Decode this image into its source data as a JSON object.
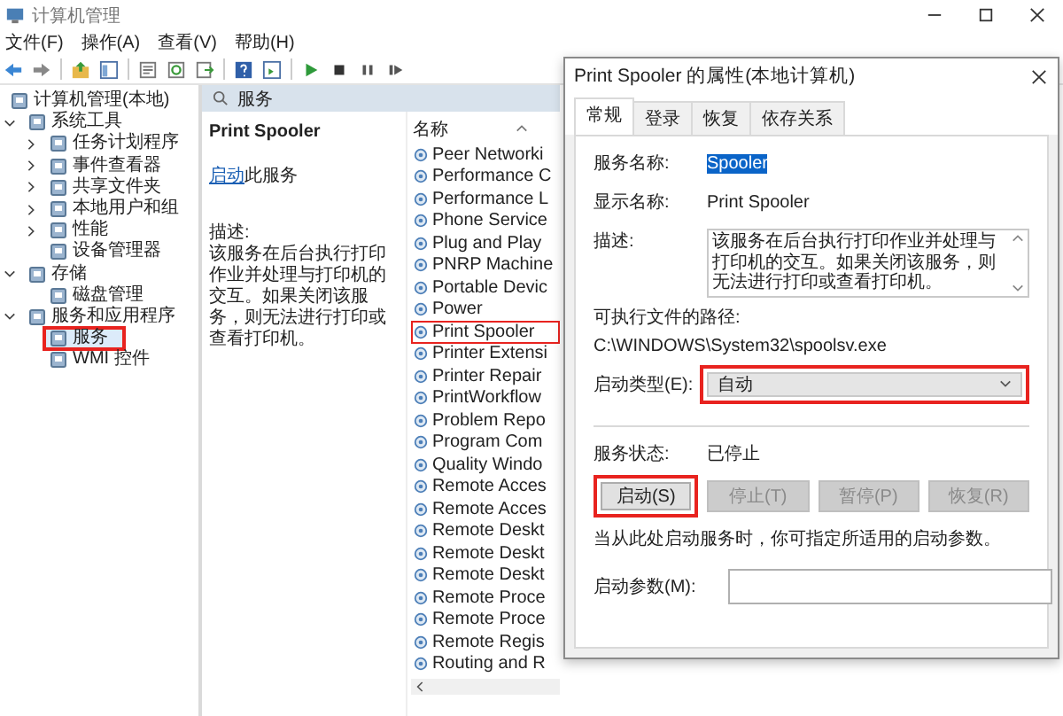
{
  "window": {
    "title": "计算机管理"
  },
  "menu": [
    "文件(F)",
    "操作(A)",
    "查看(V)",
    "帮助(H)"
  ],
  "tree": {
    "label": "计算机管理(本地)",
    "selected": false,
    "highlighted": false,
    "children": [
      {
        "label": "系统工具",
        "expanded": true,
        "selected": false,
        "highlighted": false,
        "children": [
          {
            "label": "任务计划程序",
            "expanded": false,
            "selected": false,
            "highlighted": false
          },
          {
            "label": "事件查看器",
            "expanded": false,
            "selected": false,
            "highlighted": false
          },
          {
            "label": "共享文件夹",
            "expanded": false,
            "selected": false,
            "highlighted": false
          },
          {
            "label": "本地用户和组",
            "expanded": false,
            "selected": false,
            "highlighted": false
          },
          {
            "label": "性能",
            "expanded": false,
            "selected": false,
            "highlighted": false
          },
          {
            "label": "设备管理器",
            "selected": false,
            "highlighted": false
          }
        ]
      },
      {
        "label": "存储",
        "expanded": true,
        "selected": false,
        "highlighted": false,
        "children": [
          {
            "label": "磁盘管理",
            "selected": false,
            "highlighted": false
          }
        ]
      },
      {
        "label": "服务和应用程序",
        "expanded": true,
        "selected": false,
        "highlighted": false,
        "children": [
          {
            "label": "服务",
            "selected": true,
            "highlighted": true
          },
          {
            "label": "WMI 控件",
            "selected": false,
            "highlighted": false
          }
        ]
      }
    ]
  },
  "services_panel": {
    "title": "服务",
    "detail": {
      "name": "Print Spooler",
      "action_link": "启动",
      "action_text": "此服务",
      "description_label": "描述:",
      "description": "该服务在后台执行打印作业并处理与打印机的交互。如果关闭该服务，则无法进行打印或查看打印机。"
    },
    "list": {
      "column": "名称",
      "rows": [
        {
          "name": "Peer Networki",
          "highlighted": false
        },
        {
          "name": "Performance C",
          "highlighted": false
        },
        {
          "name": "Performance L",
          "highlighted": false
        },
        {
          "name": "Phone Service",
          "highlighted": false
        },
        {
          "name": "Plug and Play",
          "highlighted": false
        },
        {
          "name": "PNRP Machine",
          "highlighted": false
        },
        {
          "name": "Portable Devic",
          "highlighted": false
        },
        {
          "name": "Power",
          "highlighted": false
        },
        {
          "name": "Print Spooler",
          "highlighted": true
        },
        {
          "name": "Printer Extensi",
          "highlighted": false
        },
        {
          "name": "Printer Repair",
          "highlighted": false
        },
        {
          "name": "PrintWorkflow",
          "highlighted": false
        },
        {
          "name": "Problem Repo",
          "highlighted": false
        },
        {
          "name": "Program Com",
          "highlighted": false
        },
        {
          "name": "Quality Windo",
          "highlighted": false
        },
        {
          "name": "Remote Acces",
          "highlighted": false
        },
        {
          "name": "Remote Acces",
          "highlighted": false
        },
        {
          "name": "Remote Deskt",
          "highlighted": false
        },
        {
          "name": "Remote Deskt",
          "highlighted": false
        },
        {
          "name": "Remote Deskt",
          "highlighted": false
        },
        {
          "name": "Remote Proce",
          "highlighted": false
        },
        {
          "name": "Remote Proce",
          "highlighted": false
        },
        {
          "name": "Remote Regis",
          "highlighted": false
        },
        {
          "name": "Routing and R",
          "highlighted": false
        }
      ]
    }
  },
  "dialog": {
    "title": "Print Spooler 的属性(本地计算机)",
    "tabs": [
      {
        "label": "常规",
        "selected": true
      },
      {
        "label": "登录",
        "selected": false
      },
      {
        "label": "恢复",
        "selected": false
      },
      {
        "label": "依存关系",
        "selected": false
      }
    ],
    "service_name": {
      "label": "服务名称:",
      "value": "Spooler",
      "selected": true
    },
    "display_name": {
      "label": "显示名称:",
      "value": "Print Spooler"
    },
    "description": {
      "label": "描述:",
      "value": "该服务在后台执行打印作业并处理与打印机的交互。如果关闭该服务，则无法进行打印或查看打印机。"
    },
    "path": {
      "label": "可执行文件的路径:",
      "value": "C:\\WINDOWS\\System32\\spoolsv.exe"
    },
    "startup_type": {
      "label": "启动类型(E):",
      "value": "自动",
      "highlighted": true
    },
    "status": {
      "label": "服务状态:",
      "value": "已停止"
    },
    "buttons": [
      {
        "label": "启动(S)",
        "disabled": false,
        "highlighted": true
      },
      {
        "label": "停止(T)",
        "disabled": true,
        "highlighted": false
      },
      {
        "label": "暂停(P)",
        "disabled": true,
        "highlighted": false
      },
      {
        "label": "恢复(R)",
        "disabled": true,
        "highlighted": false
      }
    ],
    "hint": "当从此处启动服务时，你可指定所适用的启动参数。",
    "start_params": {
      "label": "启动参数(M):"
    }
  }
}
